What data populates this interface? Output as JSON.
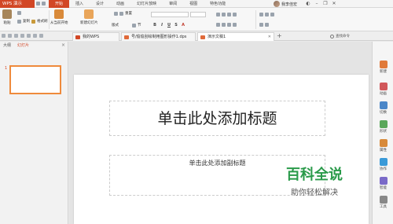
{
  "app": {
    "title": "WPS 演示"
  },
  "tabs": [
    "开始",
    "插入",
    "设计",
    "动画",
    "幻灯片放映",
    "审阅",
    "视图",
    "特色功能"
  ],
  "user": {
    "name": "我李佳宏"
  },
  "ribbon": {
    "paste": "粘贴",
    "copy": "复制",
    "format_painter": "格式刷",
    "from_current": "从当前开始",
    "new_slide": "新建幻灯片",
    "layout": "版式",
    "section": "节",
    "reset": "重置"
  },
  "documents": [
    {
      "label": "我的WPS"
    },
    {
      "label": "号/偷偷刮绘制用图形操作1.dps"
    },
    {
      "label": "演示文稿1"
    }
  ],
  "search_command": "查找命令",
  "left_panel": {
    "tabs": [
      "大纲",
      "幻灯片"
    ],
    "slide_number": "1"
  },
  "slide": {
    "title_placeholder": "单击此处添加标题",
    "subtitle_placeholder": "单击此处添加副标题"
  },
  "right_sidebar": [
    "新建",
    "动画",
    "切换",
    "形状",
    "属性",
    "协作",
    "智能",
    "工具"
  ],
  "watermark": {
    "logo": "百科全说",
    "tagline": "助你轻松解决"
  },
  "colors": {
    "accent": "#d24726",
    "selection": "#ef8a3c",
    "watermark_green": "#2a9a4a"
  }
}
